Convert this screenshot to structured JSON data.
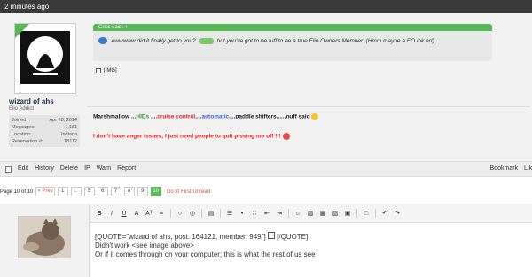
{
  "topbar": {
    "timestamp": "2 minutes ago"
  },
  "post": {
    "user": {
      "name": "wizard of ahs",
      "title": "Elio Addict",
      "stats": [
        {
          "label": "Joined:",
          "value": "Apr 28, 2014"
        },
        {
          "label": "Messages:",
          "value": "1,181"
        },
        {
          "label": "Location:",
          "value": "Indiana"
        },
        {
          "label": "Reservation #:",
          "value": "18112"
        }
      ]
    },
    "quote": {
      "header": "Criss said: ↑",
      "text_a": "Awwwww did it finally get to you?",
      "text_b": "but you've got to be tuff to be a true Elio Owners Member. (Hmm maybe a EO ink art)"
    },
    "img_label": "[IMG]",
    "signature": {
      "lead": "Marshmallow ...",
      "hids": "HIDs",
      "sep1": " ....",
      "cruise": "cruise control",
      "sep2": "....",
      "automatic": "automatic",
      "rest": "....paddle shifters......nuff said",
      "line2": "I don't have anger issues, I just need people to quit pissing me off !!!"
    }
  },
  "actions": {
    "left": [
      "Edit",
      "History",
      "Delete",
      "IP",
      "Warn",
      "Report"
    ],
    "right": [
      "Bookmark",
      "Lik"
    ]
  },
  "pagination": {
    "label": "Page 10 of 10",
    "prev": "« Prev",
    "pages": [
      "1",
      "←",
      "5",
      "6",
      "7",
      "8",
      "9",
      "10"
    ],
    "current": "10",
    "first_unread": "Go to First Unread"
  },
  "editor": {
    "toolbar": [
      "B",
      "I",
      "U",
      "A",
      "Aᵀ",
      "≡",
      "○",
      "◎",
      "▤",
      "☰",
      "•",
      "∷",
      "⇤",
      "⇥",
      "☺",
      "▨",
      "▦",
      "▧",
      "▣",
      "□",
      "↶",
      "↷"
    ],
    "line1": "[QUOTE=\"wizard of ahs, post: 164121, member: 949\"]",
    "line1_end": "[/QUOTE]",
    "line2": "Didn't work <see image above>",
    "line3": "Or if it comes through on your computer; this is what the rest of us see"
  }
}
